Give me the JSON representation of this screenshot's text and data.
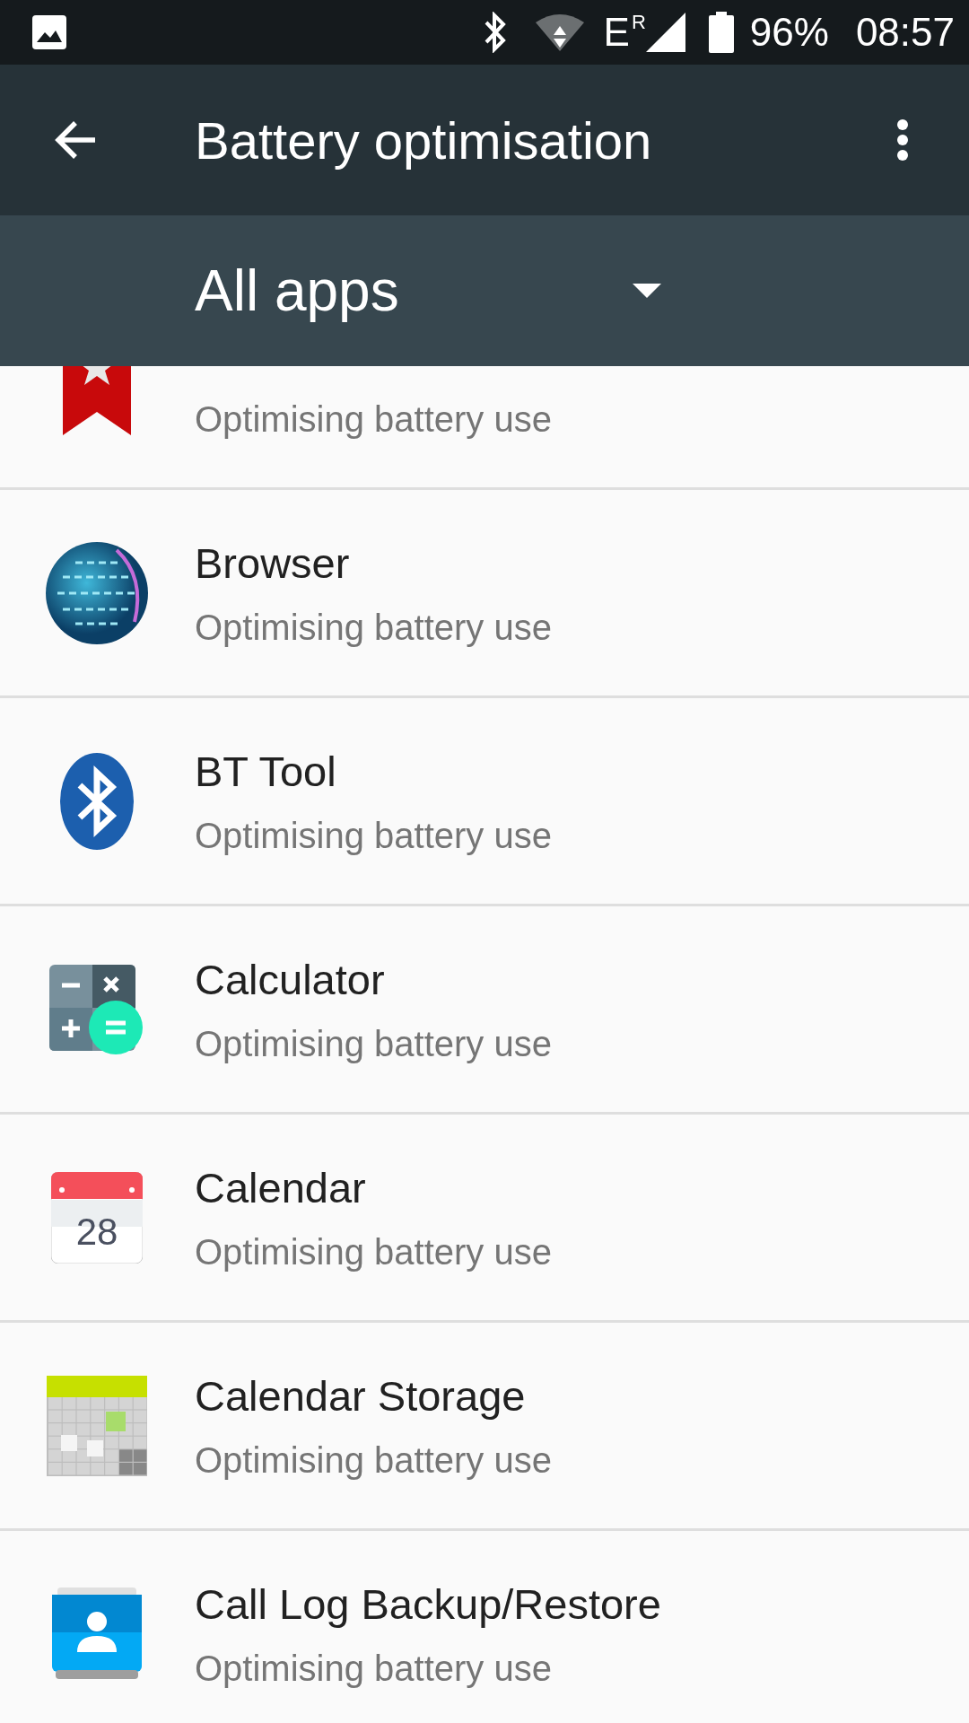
{
  "status_bar": {
    "network_type": "E",
    "roaming": "R",
    "battery": "96%",
    "time": "08:57"
  },
  "toolbar": {
    "title": "Battery optimisation"
  },
  "filter": {
    "value": "All apps"
  },
  "apps": [
    {
      "kind": "bookmark",
      "subtitle": "Optimising battery use"
    },
    {
      "kind": "globe",
      "title": "Browser",
      "subtitle": "Optimising battery use"
    },
    {
      "kind": "bluetooth",
      "title": "BT Tool",
      "subtitle": "Optimising battery use"
    },
    {
      "kind": "calculator",
      "title": "Calculator",
      "subtitle": "Optimising battery use"
    },
    {
      "kind": "calendar",
      "title": "Calendar",
      "subtitle": "Optimising battery use",
      "icon_text": "28"
    },
    {
      "kind": "calendar-grid",
      "title": "Calendar Storage",
      "subtitle": "Optimising battery use"
    },
    {
      "kind": "contacts",
      "title": "Call Log Backup/Restore",
      "subtitle": "Optimising battery use"
    }
  ]
}
